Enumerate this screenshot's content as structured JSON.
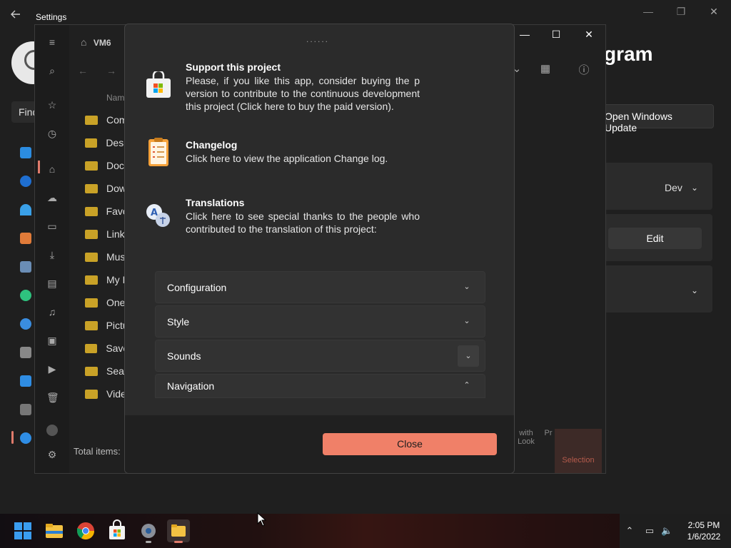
{
  "settings": {
    "title": "Settings",
    "find_text": "Find",
    "heading": "gram",
    "update_button": "Open Windows Update",
    "channel_value": "Dev",
    "edit_button": "Edit"
  },
  "files": {
    "breadcrumb": "VM6",
    "column_name": "Nam",
    "items": [
      "Com",
      "Desk",
      "Doc",
      "Dow",
      "Favo",
      "Link",
      "Mus",
      "My I",
      "One",
      "Pictu",
      "Save",
      "Sear",
      "Vide"
    ],
    "status": "Total items:",
    "bottom_buttons": [
      "with Look",
      "Pr"
    ],
    "selection_label": "Selection"
  },
  "dialog": {
    "cut_title": "......",
    "items": [
      {
        "title": "Support this project",
        "description": "Please, if you like this app, consider buying the p version to contribute to the continuous development this project (Click here to buy the paid version).",
        "icon": "store-bag-icon"
      },
      {
        "title": "Changelog",
        "description": "Click here to view the application Change log.",
        "icon": "clipboard-icon"
      },
      {
        "title": "Translations",
        "description": "Click here to see special thanks to the people who contributed to the translation of this project:",
        "icon": "translate-icon"
      }
    ],
    "sections": [
      {
        "label": "Configuration",
        "state": "collapsed"
      },
      {
        "label": "Style",
        "state": "collapsed"
      },
      {
        "label": "Sounds",
        "state": "collapsed"
      },
      {
        "label": "Navigation",
        "state": "expanded"
      }
    ],
    "close_button": "Close",
    "accent": "#f08068"
  },
  "taskbar": {
    "time": "2:05 PM",
    "date": "1/6/2022",
    "apps": [
      "windows-start-icon",
      "file-explorer-icon",
      "chrome-icon",
      "store-icon",
      "settings-icon",
      "files-app-icon"
    ]
  }
}
